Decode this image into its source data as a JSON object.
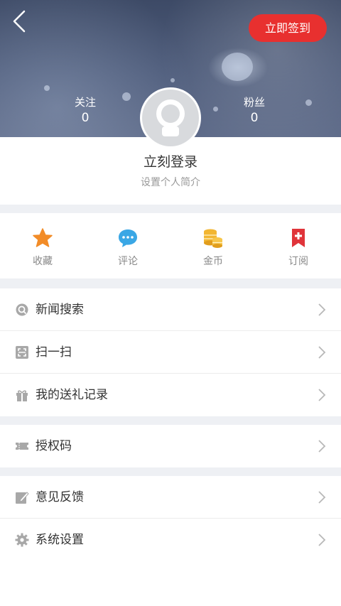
{
  "header": {
    "checkin_label": "立即签到",
    "stats": {
      "follow": {
        "label": "关注",
        "value": "0"
      },
      "fans": {
        "label": "粉丝",
        "value": "0"
      }
    }
  },
  "profile": {
    "name": "立刻登录",
    "bio": "设置个人简介"
  },
  "quick_actions": [
    {
      "label": "收藏",
      "icon": "star-icon",
      "color": "#f28c28"
    },
    {
      "label": "评论",
      "icon": "comment-icon",
      "color": "#3aa7e5"
    },
    {
      "label": "金币",
      "icon": "coins-icon",
      "color": "#f2b632"
    },
    {
      "label": "订阅",
      "icon": "subscribe-bookmark-icon",
      "color": "#e0343a"
    }
  ],
  "menu": {
    "group1": [
      {
        "label": "新闻搜索",
        "icon": "search-icon"
      },
      {
        "label": "扫一扫",
        "icon": "scan-icon"
      },
      {
        "label": "我的送礼记录",
        "icon": "gift-icon"
      }
    ],
    "group2": [
      {
        "label": "授权码",
        "icon": "ticket-icon"
      }
    ],
    "group3": [
      {
        "label": "意见反馈",
        "icon": "edit-feedback-icon"
      },
      {
        "label": "系统设置",
        "icon": "gear-icon"
      }
    ]
  },
  "colors": {
    "accent_red": "#e8302f",
    "icon_gray": "#a8a8a8",
    "divider": "#eef0f4"
  }
}
